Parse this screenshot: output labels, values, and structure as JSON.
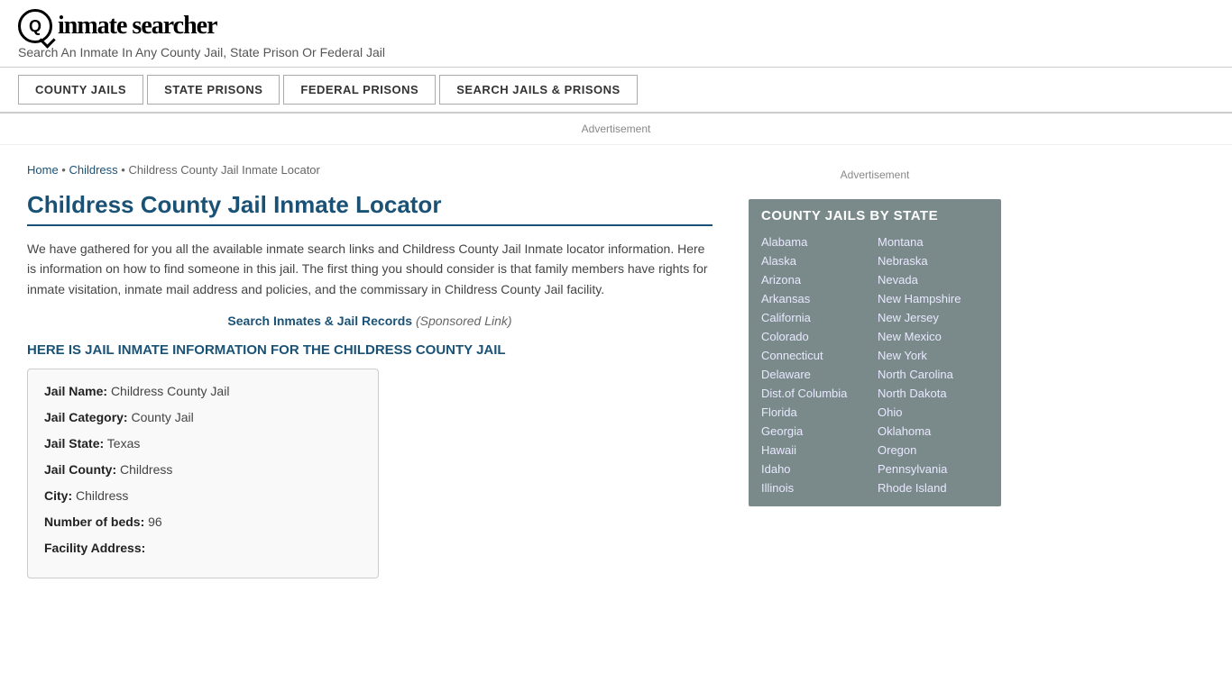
{
  "header": {
    "logo_text": "inmate searcher",
    "tagline": "Search An Inmate In Any County Jail, State Prison Or Federal Jail"
  },
  "nav": {
    "buttons": [
      {
        "label": "COUNTY JAILS",
        "name": "county-jails-nav"
      },
      {
        "label": "STATE PRISONS",
        "name": "state-prisons-nav"
      },
      {
        "label": "FEDERAL PRISONS",
        "name": "federal-prisons-nav"
      },
      {
        "label": "SEARCH JAILS & PRISONS",
        "name": "search-jails-nav"
      }
    ]
  },
  "ad_banner": "Advertisement",
  "breadcrumb": {
    "home": "Home",
    "parent": "Childress",
    "current": "Childress County Jail Inmate Locator"
  },
  "page": {
    "title": "Childress County Jail Inmate Locator",
    "body_text": "We have gathered for you all the available inmate search links and Childress County Jail Inmate locator information. Here is information on how to find someone in this jail. The first thing you should consider is that family members have rights for inmate visitation, inmate mail address and policies, and the commissary in Childress County Jail facility.",
    "sponsored_link_text": "Search Inmates & Jail Records",
    "sponsored_label": "(Sponsored Link)",
    "section_heading": "HERE IS JAIL INMATE INFORMATION FOR THE CHILDRESS COUNTY JAIL"
  },
  "jail_info": {
    "name_label": "Jail Name:",
    "name_value": "Childress County Jail",
    "category_label": "Jail Category:",
    "category_value": "County Jail",
    "state_label": "Jail State:",
    "state_value": "Texas",
    "county_label": "Jail County:",
    "county_value": "Childress",
    "city_label": "City:",
    "city_value": "Childress",
    "beds_label": "Number of beds:",
    "beds_value": "96",
    "address_label": "Facility Address:"
  },
  "sidebar": {
    "ad_label": "Advertisement",
    "county_jails_title": "COUNTY JAILS BY STATE",
    "states_col1": [
      "Alabama",
      "Alaska",
      "Arizona",
      "Arkansas",
      "California",
      "Colorado",
      "Connecticut",
      "Delaware",
      "Dist.of Columbia",
      "Florida",
      "Georgia",
      "Hawaii",
      "Idaho",
      "Illinois"
    ],
    "states_col2": [
      "Montana",
      "Nebraska",
      "Nevada",
      "New Hampshire",
      "New Jersey",
      "New Mexico",
      "New York",
      "North Carolina",
      "North Dakota",
      "Ohio",
      "Oklahoma",
      "Oregon",
      "Pennsylvania",
      "Rhode Island"
    ]
  }
}
